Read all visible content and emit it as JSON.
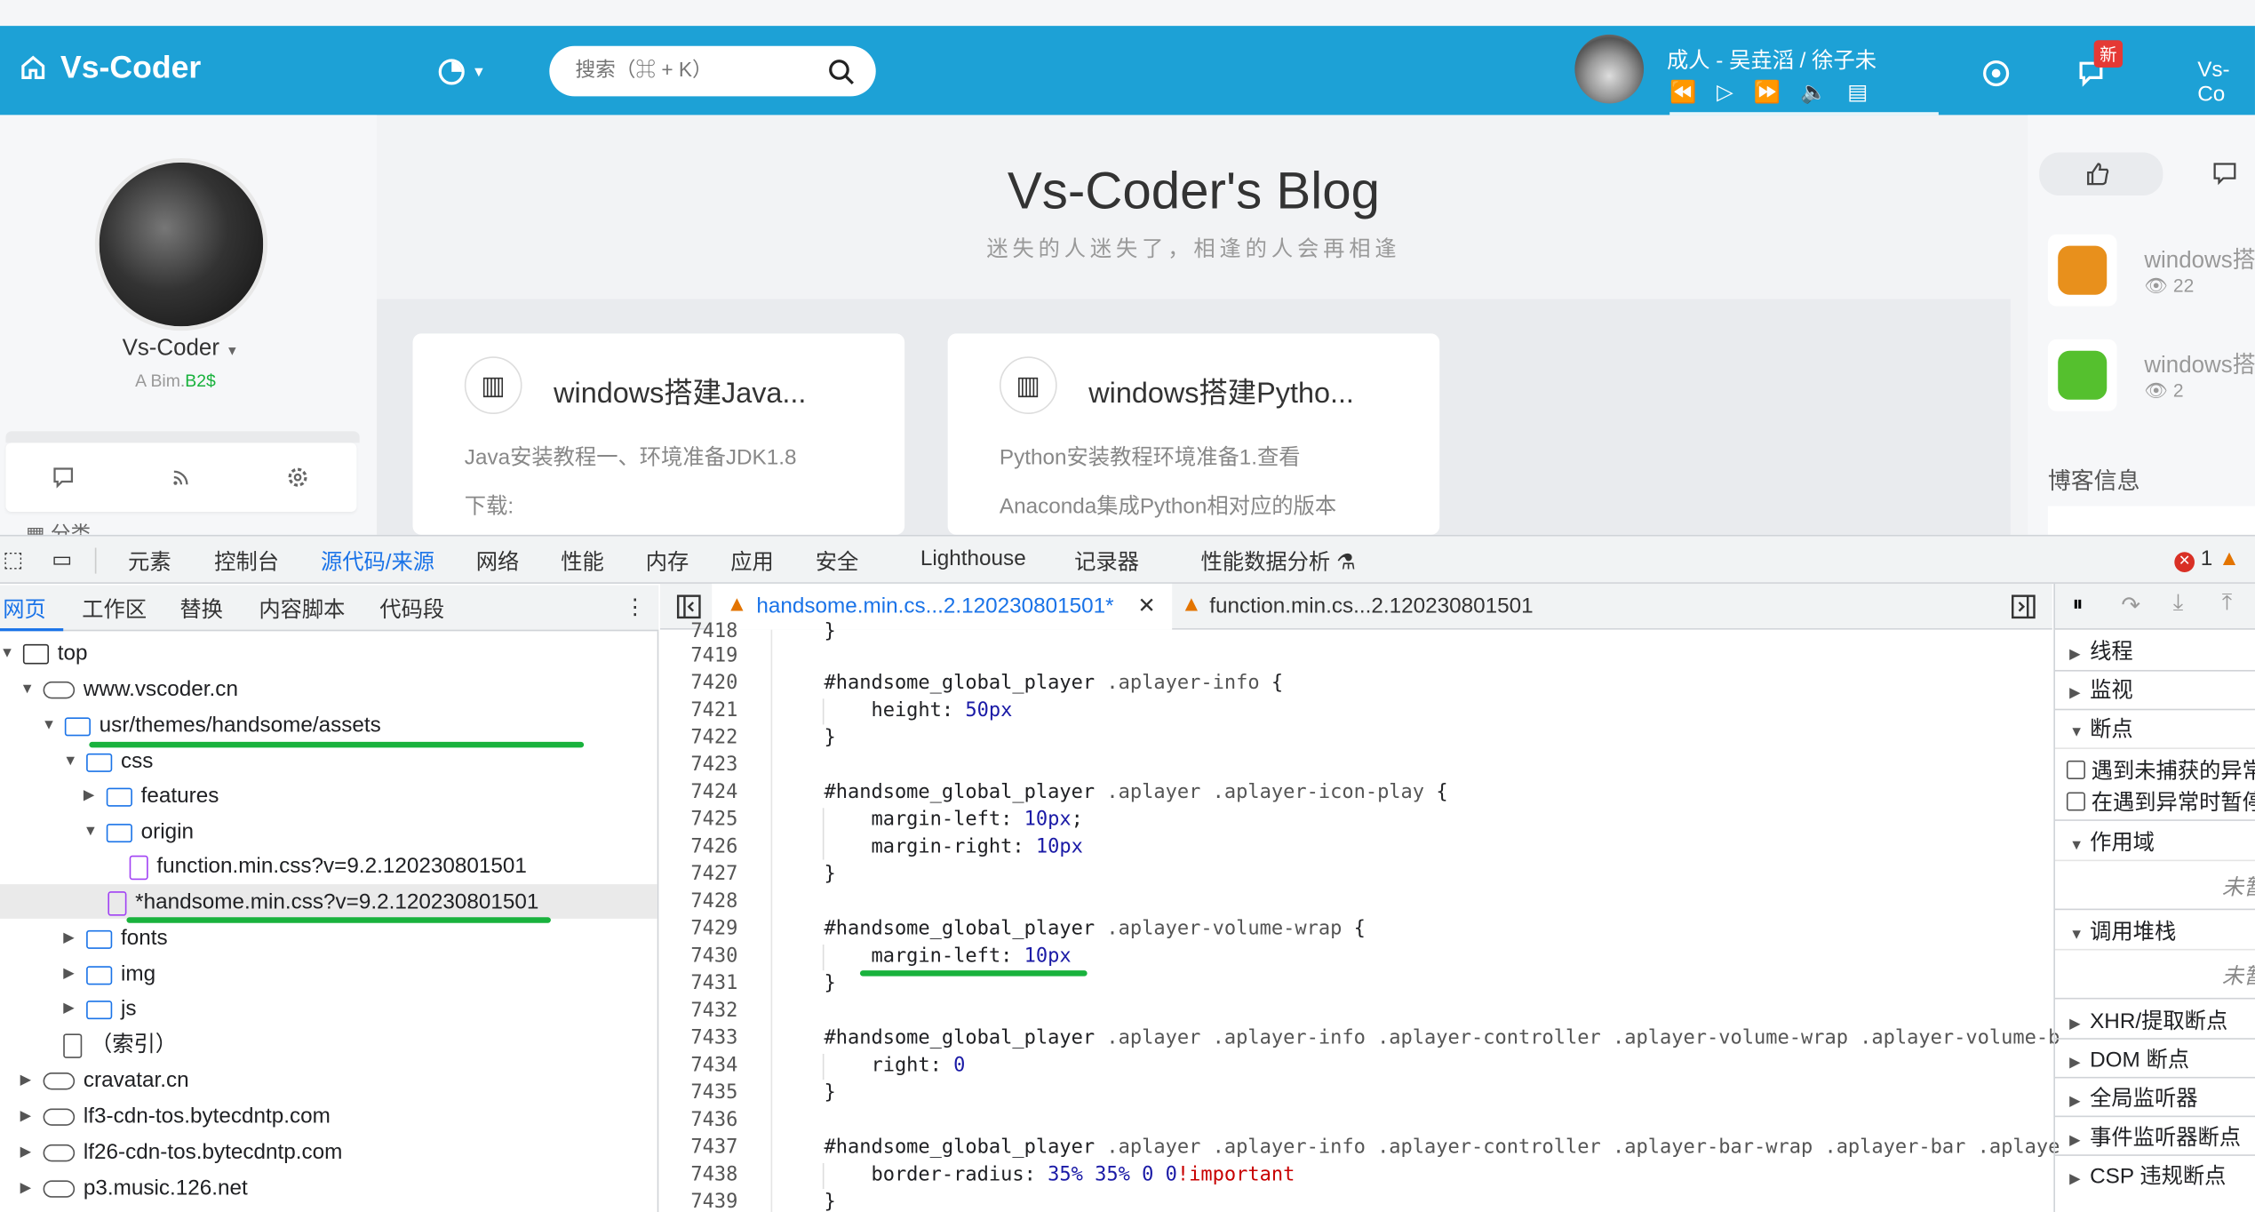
{
  "blog": {
    "logo": "Vs-Coder",
    "search_placeholder": "搜索（⌘ + K）",
    "song": "成人 - 吴垚滔 / 徐子未",
    "badge_new": "新",
    "header_right": "Vs-Co",
    "title": "Vs-Coder's Blog",
    "subtitle": "迷失的人迷失了，相逢的人会再相逢",
    "user_name": "Vs-Coder",
    "user_sub_a": "A ",
    "user_sub_b": "Bim.",
    "user_sub_c": "B2$",
    "left_partial": "分类",
    "cards": [
      {
        "title": "windows搭建Java...",
        "desc_line1": "Java安装教程一、环境准备JDK1.8",
        "desc_line2": "下载:"
      },
      {
        "title": "windows搭建Pytho...",
        "desc_line1": "Python安装教程环境准备1.查看",
        "desc_line2": "Anaconda集成Python相对应的版本"
      }
    ],
    "right_posts": [
      {
        "title": "windows搭",
        "views": "22"
      },
      {
        "title": "windows搭",
        "views": "2"
      }
    ],
    "blog_info": "博客信息"
  },
  "devtools": {
    "tabs": [
      "元素",
      "控制台",
      "源代码/来源",
      "网络",
      "性能",
      "内存",
      "应用",
      "安全",
      "Lighthouse",
      "记录器",
      "性能数据分析"
    ],
    "error_count": "1",
    "nav_tabs": [
      "网页",
      "工作区",
      "替换",
      "内容脚本",
      "代码段"
    ],
    "tree": {
      "top": "top",
      "host1": "www.vscoder.cn",
      "assets": "usr/themes/handsome/assets",
      "css": "css",
      "features": "features",
      "origin": "origin",
      "file1": "function.min.css?v=9.2.120230801501",
      "file2": "*handsome.min.css?v=9.2.120230801501",
      "fonts": "fonts",
      "img": "img",
      "js": "js",
      "index": "（索引）",
      "host2": "cravatar.cn",
      "host3": "lf3-cdn-tos.bytecdntp.com",
      "host4": "lf26-cdn-tos.bytecdntp.com",
      "host5": "p3.music.126.net"
    },
    "editor_tabs": [
      "handsome.min.cs...2.120230801501*",
      "function.min.cs...2.120230801501"
    ],
    "line_numbers": [
      "7418",
      "7419",
      "7420",
      "7421",
      "7422",
      "7423",
      "7424",
      "7425",
      "7426",
      "7427",
      "7428",
      "7429",
      "7430",
      "7431",
      "7432",
      "7433",
      "7434",
      "7435",
      "7436",
      "7437",
      "7438",
      "7439"
    ],
    "code": {
      "l7418": "}",
      "l7420_a": "#handsome_global_player ",
      "l7420_b": ".aplayer-info",
      "l7420_c": " {",
      "l7421_a": "    height: ",
      "l7421_b": "50px",
      "l7422": "}",
      "l7424_a": "#handsome_global_player ",
      "l7424_b": ".aplayer .aplayer-icon-play",
      "l7424_c": " {",
      "l7425_a": "    margin-left: ",
      "l7425_b": "10px",
      "l7425_c": ";",
      "l7426_a": "    margin-right: ",
      "l7426_b": "10px",
      "l7427": "}",
      "l7429_a": "#handsome_global_player ",
      "l7429_b": ".aplayer-volume-wrap",
      "l7429_c": " {",
      "l7430_a": "    margin-left: ",
      "l7430_b": "10px",
      "l7431": "}",
      "l7433_a": "#handsome_global_player ",
      "l7433_b": ".aplayer .aplayer-info .aplayer-controller .aplayer-volume-wrap .aplayer-volume-b",
      "l7434_a": "    right: ",
      "l7434_b": "0",
      "l7435": "}",
      "l7437_a": "#handsome_global_player ",
      "l7437_b": ".aplayer .aplayer-info .aplayer-controller .aplayer-bar-wrap .aplayer-bar .aplaye",
      "l7438_a": "    border-radius: ",
      "l7438_b": "35% 35% 0 0",
      "l7438_c": "!important",
      "l7439": "}"
    },
    "right_panel": {
      "threads": "线程",
      "watch": "监视",
      "breakpoints": "断点",
      "cb1": "遇到未捕获的异常",
      "cb2": "在遇到异常时暂停",
      "scope": "作用域",
      "not_paused_1": "未暂",
      "call_stack": "调用堆栈",
      "not_paused_2": "未暂",
      "xhr": "XHR/提取断点",
      "dom": "DOM 断点",
      "global": "全局监听器",
      "event": "事件监听器断点",
      "csp": "CSP 违规断点"
    }
  },
  "colors": {
    "accent": "#1da1d6",
    "devtools_blue": "#1a73e8",
    "highlight_green": "#19b23d"
  }
}
